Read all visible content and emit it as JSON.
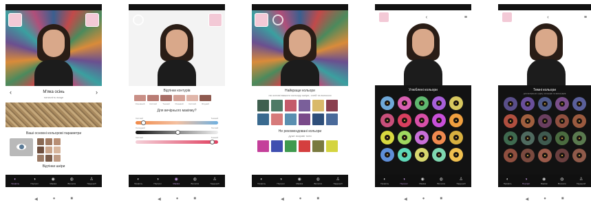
{
  "phones": [
    {
      "season": {
        "title": "М'яка осінь",
        "subtitle": "натисніть вище"
      },
      "section_title": "Ваші основні кольорові параметри",
      "bottom_caption": "Відтінки шкіри",
      "swatches": [
        "#8a6a55",
        "#a07a62",
        "#b88f75",
        "#6e4f3f",
        "#c9a48a",
        "#d7b59c",
        "#9b7b66",
        "#7a5c4a",
        "#bf9c85"
      ]
    },
    {
      "title": "Відтінки контурів",
      "strip_colors": [
        "#c98f86",
        "#b97c74",
        "#a86e66",
        "#d4a297",
        "#e0b6aa",
        "#8e5a4f"
      ],
      "strip_labels": [
        "Основний",
        "Світлий",
        "Темний",
        "Рожевий",
        "Світлий",
        "Ягідний"
      ],
      "question": "Для вечірнього макіяжу?",
      "slider_labels": [
        [
          "Світлий",
          "Темний"
        ],
        [
          "Холодний",
          "Теплий"
        ],
        [
          "Світлий",
          "Темний"
        ]
      ]
    },
    {
      "title": "Найкраще кольори",
      "subtitle": "на основі вашого кольору шкіри, очей та волосся",
      "palette": [
        "#3f5f4f",
        "#4e7a66",
        "#c45a6a",
        "#7a5f9a",
        "#d9b96a",
        "#8a3f4f",
        "#3a6a8f",
        "#d67a7a",
        "#5a8fb0",
        "#7a4a8a",
        "#2f4f7a",
        "#4a6a9a"
      ],
      "avoid_title": "Не рекомендовані кольори",
      "avoid_subtitle": "дуже яскраві тони",
      "avoid": [
        "#c43f9a",
        "#3f4fb0",
        "#3f9a4f",
        "#d43f3f",
        "#7a7a3f",
        "#d4d43f"
      ]
    },
    {
      "title": "Улюблені кольори",
      "dots": [
        "#6fa8d8",
        "#d85fb0",
        "#5fb86f",
        "#a85fd8",
        "#d8c85f",
        "#c84f7a",
        "#d83f5f",
        "#d84fa8",
        "#c84fd8",
        "#f0a03f",
        "#d8d83f",
        "#9fd85f",
        "#c86fd8",
        "#f08a4f",
        "#d8b03f",
        "#5f8fd8",
        "#5fd8b8",
        "#d8d86f",
        "#7fd8b0",
        "#f0c04f"
      ]
    },
    {
      "title": "Темні кольори",
      "subtitle": "для вечірнього одягу, кольорів та аксесуарів",
      "dots": [
        "#5a4f8a",
        "#6a4f9a",
        "#4f5a8a",
        "#7a4f8a",
        "#5a5f9a",
        "#b04f3f",
        "#a05f3f",
        "#6a3f5f",
        "#8f4f3f",
        "#9a5a3f",
        "#3f6a4f",
        "#4f6a5f",
        "#3f5a4f",
        "#4a6a3f",
        "#5a7a4f",
        "#8f4f3f",
        "#7a4a3f",
        "#9a5a4a",
        "#6a3f3f",
        "#8f5a4a"
      ]
    }
  ],
  "nav_labels": [
    "Профіль",
    "Портрет",
    "Макіяж",
    "Волосся",
    "Гардероб"
  ],
  "nav_glyphs": [
    "◐",
    "◑",
    "◉",
    "◍",
    "♙"
  ],
  "system_nav": [
    "◀",
    "●",
    "■"
  ]
}
